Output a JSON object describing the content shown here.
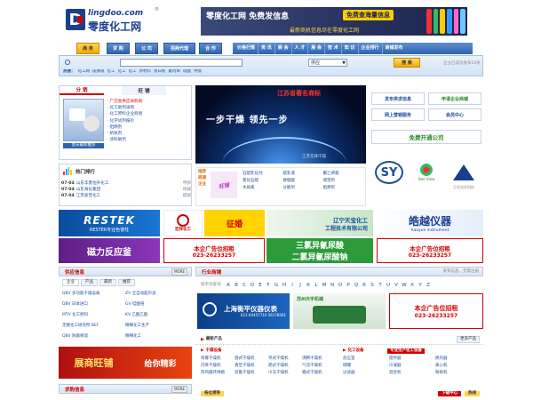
{
  "logo": {
    "domain": "lingdoo.com",
    "reg": "®",
    "name": "零度化工网",
    "mark": "D"
  },
  "banner": {
    "title": "零度化工网  免费发信息",
    "badge": "免费查海量信息",
    "sub": "最新商机信息尽在零度化工网"
  },
  "tabs": [
    {
      "label": "商 务",
      "active": true
    },
    {
      "label": "求 购",
      "active": false
    },
    {
      "label": "公 司",
      "active": false
    },
    {
      "label": "招商代理",
      "active": false
    },
    {
      "label": "合 作",
      "active": false
    }
  ],
  "nav": [
    "价格行情",
    "资 讯",
    "展 会",
    "人 才",
    "展 会",
    "技 术",
    "知 识",
    "企业排行",
    "商铺发布"
  ],
  "search": {
    "placeholder": "",
    "select": "供应",
    "button": "搜 索",
    "right": "企业已成功发布10条"
  },
  "hot": {
    "label": "热搜：",
    "items": [
      "化工网",
      "皮肤硝",
      "化工",
      "化工",
      "化工",
      "原材料",
      "钛白粉",
      "聚丙烯",
      "硫酸",
      "甲醇"
    ]
  },
  "left_tabs": [
    "分 销",
    "旺 铺"
  ],
  "left_list": [
    "广交会供应采购商",
    "化工助剂采购",
    "化工原料企业商情",
    "化学试剂报价",
    "阻燃剂",
    "抗氧剂",
    "涂料助剂"
  ],
  "left_img_caption": "会员最新推荐",
  "ranking": {
    "title": "热门排行",
    "rows": [
      {
        "date": "07-04",
        "text": "山东华鲁恒升化工",
        "tail": "甲醇"
      },
      {
        "date": "07-04",
        "text": "山东海化集团",
        "tail": "纯碱"
      },
      {
        "date": "07-04",
        "text": "江苏索普化工",
        "tail": "醋酸"
      }
    ]
  },
  "center_ad": {
    "title": "江苏省著名商标",
    "slogan": "一步干燥  领先一步",
    "sub": "江苏先锋干燥"
  },
  "center_bottom": {
    "labels": [
      "推荐",
      "商铺",
      "企业"
    ],
    "items": [
      "石蜡乳化剂",
      "蜡乳液",
      "聚乙烯蜡",
      "氯化石蜡",
      "硬脂酸",
      "增塑剂",
      "木质素",
      "分散剂",
      "阻燃剂"
    ]
  },
  "right_buttons": [
    {
      "label": "发布供求信息"
    },
    {
      "label": "申请企业商铺"
    },
    {
      "label": "网上营销服务"
    },
    {
      "label": "会员中心"
    },
    {
      "label": "免费开通公司"
    }
  ],
  "right_logos": [
    "SY",
    "Dee View",
    "三角形标志"
  ],
  "right_logo_caption": [
    "",
    "",
    "王氏化学科技"
  ],
  "ads_row1": [
    {
      "text": "RESTEK",
      "sub": "RESTEK专业色谱柱"
    },
    {
      "text": "宏祥化工",
      "sub": ""
    },
    {
      "text": "征婚",
      "sub": ""
    },
    {
      "text": "辽宁天宝化工",
      "sub": "工程技术有限公司"
    },
    {
      "text": "皓越仪器",
      "sub": "haoyue instrument"
    }
  ],
  "ads_row2": [
    {
      "text": "磁力反应釜"
    },
    {
      "text": "本企广告位招租",
      "tel": "023-26233257"
    },
    {
      "text": "三氯异氰尿酸"
    },
    {
      "text": "二氯异氰尿酸钠"
    },
    {
      "text": "本企广告位招租",
      "tel": "023-26233257"
    }
  ],
  "supply": {
    "title": "供应信息",
    "more": "MORE",
    "tabs": [
      "企业",
      "产品",
      "最新",
      "推荐"
    ],
    "rows": [
      [
        "QBV 多功能干燥设备",
        "ZV 全自动超声波"
      ],
      [
        "DBV 日本进口",
        "GV 硅酸锆"
      ],
      [
        "MTV 化工原料",
        "KV 乙酸乙酯"
      ],
      [
        "无锡化工研究所 BEF",
        "精细化工生产"
      ],
      [
        "QBV 防腐保温",
        "精细化工"
      ]
    ]
  },
  "zhan_ad": {
    "text": "展商旺铺",
    "sub": "给你精彩"
  },
  "industry": {
    "title": "行业商铺",
    "more": "发布信息，无需注册",
    "label": "按字母查询",
    "letters": [
      "A",
      "B",
      "C",
      "D",
      "E",
      "F",
      "G",
      "H",
      "I",
      "J",
      "K",
      "L",
      "M",
      "N",
      "O",
      "P",
      "Q",
      "R",
      "S",
      "T",
      "U",
      "V",
      "W",
      "X",
      "Y",
      "Z"
    ]
  },
  "ads_row3": [
    {
      "text": "上海衡平仪器仪表",
      "tel": "021-64457716  56178001"
    },
    {
      "text": "苏州天宇机械",
      "sub": ""
    },
    {
      "text": "本企广告位招租",
      "tel": "023-26233257"
    }
  ],
  "products": {
    "title": "最新产品",
    "more": "更多产品"
  },
  "cat_left": {
    "title": "干燥设备",
    "rows": [
      [
        "喷雾干燥机",
        "盘式干燥机",
        "带式干燥机",
        "沸腾干燥机"
      ],
      [
        "闪蒸干燥机",
        "真空干燥机",
        "耙式干燥机",
        "气流干燥机"
      ],
      [
        "热风循环烘箱",
        "双锥干燥机",
        "冷冻干燥机",
        "箱式干燥机"
      ]
    ]
  },
  "cat_right": {
    "title": "化工设备",
    "tag": "专业生产化工设备",
    "rows": [
      [
        "反应釜",
        "搅拌器",
        "换热器"
      ],
      [
        "储罐",
        "冷凝器",
        "离心机"
      ],
      [
        "过滤器",
        "混合机",
        "粉碎机"
      ]
    ]
  },
  "bottom": {
    "left_title": "求购信息",
    "left_more": "MORE",
    "center": [
      "各位领导  "
    ],
    "badge": "下载中心",
    "tag": "热线"
  }
}
